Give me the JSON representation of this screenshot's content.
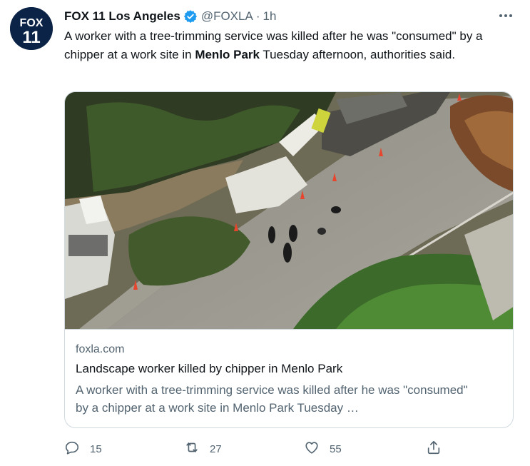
{
  "tweet": {
    "avatar_text_top": "FOX",
    "avatar_text_bottom": "11",
    "display_name": "FOX 11 Los Angeles",
    "handle": "@FOXLA",
    "separator": "·",
    "time": "1h",
    "text_part1": "A worker with a tree-trimming service was killed after he was \"consumed\" by a chipper at a work site in ",
    "text_bold": "Menlo Park",
    "text_part2": " Tuesday afternoon, authorities said."
  },
  "card": {
    "domain": "foxla.com",
    "title": "Landscape worker killed by chipper in Menlo Park",
    "description": "A worker with a tree-trimming service was killed after he was \"consumed\" by a chipper at a work site in Menlo Park Tuesday …"
  },
  "actions": {
    "reply_count": "15",
    "retweet_count": "27",
    "like_count": "55"
  },
  "icons": {
    "verified": "verified-badge-icon",
    "more": "more-icon",
    "reply": "reply-icon",
    "retweet": "retweet-icon",
    "like": "heart-icon",
    "share": "share-icon"
  },
  "colors": {
    "verified": "#1d9bf0",
    "text": "#0f1419",
    "secondary": "#536471",
    "border": "#cfd9de",
    "avatar_bg": "#0b2346"
  }
}
